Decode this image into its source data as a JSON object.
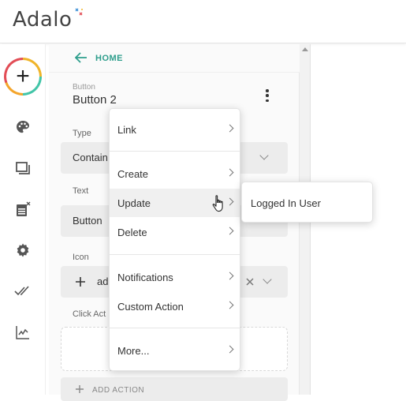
{
  "app": {
    "logo_text": "Adalo"
  },
  "rail": {
    "add_label": "+",
    "items": [
      {
        "icon": "palette-icon"
      },
      {
        "icon": "screens-icon"
      },
      {
        "icon": "data-icon"
      },
      {
        "icon": "gear-icon"
      },
      {
        "icon": "double-check-icon"
      },
      {
        "icon": "analytics-icon"
      }
    ]
  },
  "panel": {
    "home_label": "HOME",
    "component_type": "Button",
    "component_name": "Button 2",
    "fields": {
      "type_label": "Type",
      "type_value": "Contain",
      "text_label": "Text",
      "text_value": "Button",
      "icon_label": "Icon",
      "icon_value": "ad",
      "click_label": "Click Act"
    },
    "add_action_label": "ADD ACTION"
  },
  "menu": {
    "items": [
      {
        "label": "Link",
        "has_submenu": true
      },
      {
        "label": "Create",
        "has_submenu": true
      },
      {
        "label": "Update",
        "has_submenu": true,
        "hovered": true
      },
      {
        "label": "Delete",
        "has_submenu": true
      },
      {
        "label": "Notifications",
        "has_submenu": true
      },
      {
        "label": "Custom Action",
        "has_submenu": true
      },
      {
        "label": "More...",
        "has_submenu": true
      }
    ]
  },
  "submenu": {
    "items": [
      {
        "label": "Logged In User"
      }
    ]
  },
  "colors": {
    "accent": "#2e9e8c",
    "hover": "#f0f0f0"
  }
}
